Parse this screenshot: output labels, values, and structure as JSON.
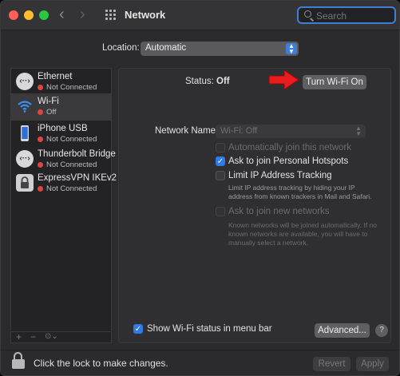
{
  "window": {
    "title": "Network",
    "search_placeholder": "Search",
    "nav_back": "‹",
    "nav_forward": "›"
  },
  "location": {
    "label": "Location:",
    "value": "Automatic"
  },
  "sidebar": {
    "items": [
      {
        "name": "Ethernet",
        "status": "Not Connected",
        "status_color": "#e0443e",
        "icon": "ethernet-icon",
        "glyph": "‹··›"
      },
      {
        "name": "Wi-Fi",
        "status": "Off",
        "status_color": "#e0443e",
        "icon": "wifi-icon",
        "selected": true
      },
      {
        "name": "iPhone USB",
        "status": "Not Connected",
        "status_color": "#e0443e",
        "icon": "iphone-icon"
      },
      {
        "name": "Thunderbolt Bridge",
        "status": "Not Connected",
        "status_color": "#e0443e",
        "icon": "thunderbolt-icon",
        "glyph": "‹··›"
      },
      {
        "name": "ExpressVPN IKEv2",
        "status": "Not Connected",
        "status_color": "#e0443e",
        "icon": "vpn-lock-icon"
      }
    ],
    "tools": {
      "add": "+",
      "remove": "−",
      "more": "⊙⌄"
    }
  },
  "panel": {
    "status_label": "Status:",
    "status_value": "Off",
    "turn_on_button": "Turn Wi-Fi On",
    "network_name_label": "Network Name:",
    "network_name_value": "Wi-Fi: Off",
    "options": [
      {
        "label": "Automatically join this network",
        "checked": false,
        "disabled": true
      },
      {
        "label": "Ask to join Personal Hotspots",
        "checked": true,
        "disabled": false
      },
      {
        "label": "Limit IP Address Tracking",
        "checked": false,
        "disabled": false
      },
      {
        "label": "Ask to join new networks",
        "checked": false,
        "disabled": true
      }
    ],
    "limit_ip_note": "Limit IP address tracking by hiding your IP address from known trackers in Mail and Safari.",
    "new_networks_note": "Known networks will be joined automatically. If no known networks are available, you will have to manually select a network.",
    "show_status_label": "Show Wi-Fi status in menu bar",
    "show_status_checked": true,
    "advanced_button": "Advanced...",
    "help_button": "?"
  },
  "footer": {
    "lock_text": "Click the lock to make changes.",
    "revert_button": "Revert",
    "apply_button": "Apply"
  },
  "colors": {
    "accent": "#2f7ae5",
    "annotation_arrow": "#e81c1c"
  }
}
